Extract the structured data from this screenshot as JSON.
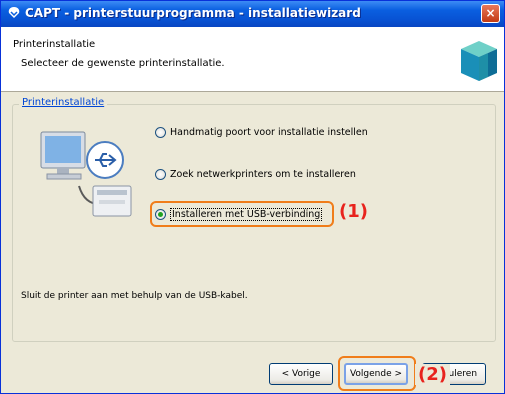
{
  "window": {
    "title": "CAPT - printerstuurprogramma - installatiewizard",
    "close_glyph": "×"
  },
  "header": {
    "title": "Printerinstallatie",
    "subtitle": "Selecteer de gewenste printerinstallatie.",
    "icon": "printer-cube-icon"
  },
  "group": {
    "label": "Printerinstallatie",
    "illustration": "computer-usb-printer-icon"
  },
  "options": [
    {
      "label": "Handmatig poort voor installatie instellen",
      "checked": false
    },
    {
      "label": "Zoek netwerkprinters om te installeren",
      "checked": false
    },
    {
      "label": "Installeren met USB-verbinding",
      "checked": true
    }
  ],
  "hint": "Sluit de printer aan met behulp van de USB-kabel.",
  "buttons": {
    "back": "< Vorige",
    "next": "Volgende >",
    "cancel": "Annuleren"
  },
  "callouts": {
    "one": "(1)",
    "two": "(2)"
  },
  "colors": {
    "accent": "#0a5fe0",
    "highlight": "#f07d1a",
    "callout": "#e8231d"
  }
}
